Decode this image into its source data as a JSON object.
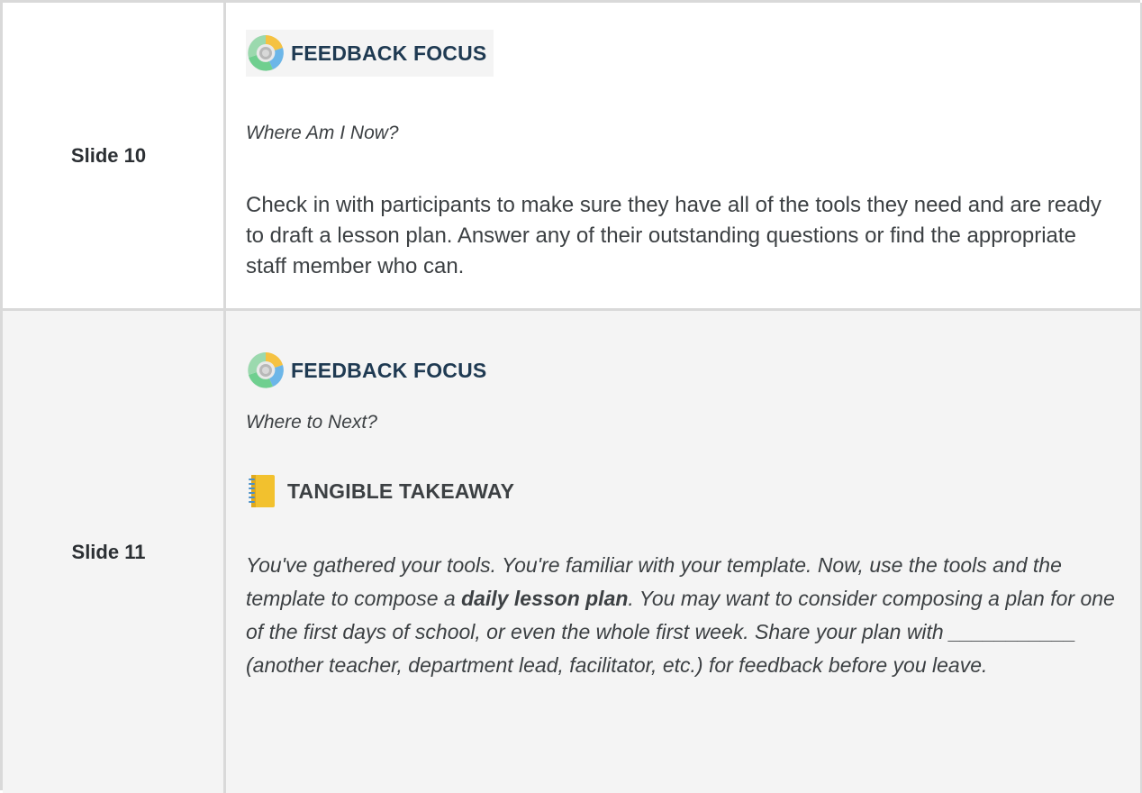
{
  "rows": [
    {
      "label": "Slide 10",
      "focus_heading": "FEEDBACK FOCUS",
      "subheading": "Where Am I Now?",
      "body": "Check in with participants to make sure they have all of the tools they need and are ready to draft a lesson plan. Answer any of their outstanding questions or find the appropriate staff member who can."
    },
    {
      "label": "Slide 11",
      "focus_heading": "FEEDBACK FOCUS",
      "subheading": "Where to Next?",
      "takeaway_heading": "TANGIBLE TAKEAWAY",
      "body_part1": "You've gathered your tools. You're familiar with your template. Now, use the tools and the template to compose a ",
      "body_bold": "daily lesson plan",
      "body_part2": ". You may want to consider composing a plan for one of the first days of school, or even the whole first week. Share your plan with ___________ (another teacher, department lead, facilitator, etc.) for feedback before you leave."
    }
  ],
  "icons": {
    "feedback_cycle": "feedback-cycle-icon",
    "notebook": "notebook-icon"
  },
  "colors": {
    "heading": "#1f3a52",
    "border": "#d9d9d9",
    "shaded_row": "#f4f4f4",
    "cycle_yellow": "#f5c242",
    "cycle_blue": "#6cb6e8",
    "cycle_green": "#6fcf8f"
  }
}
